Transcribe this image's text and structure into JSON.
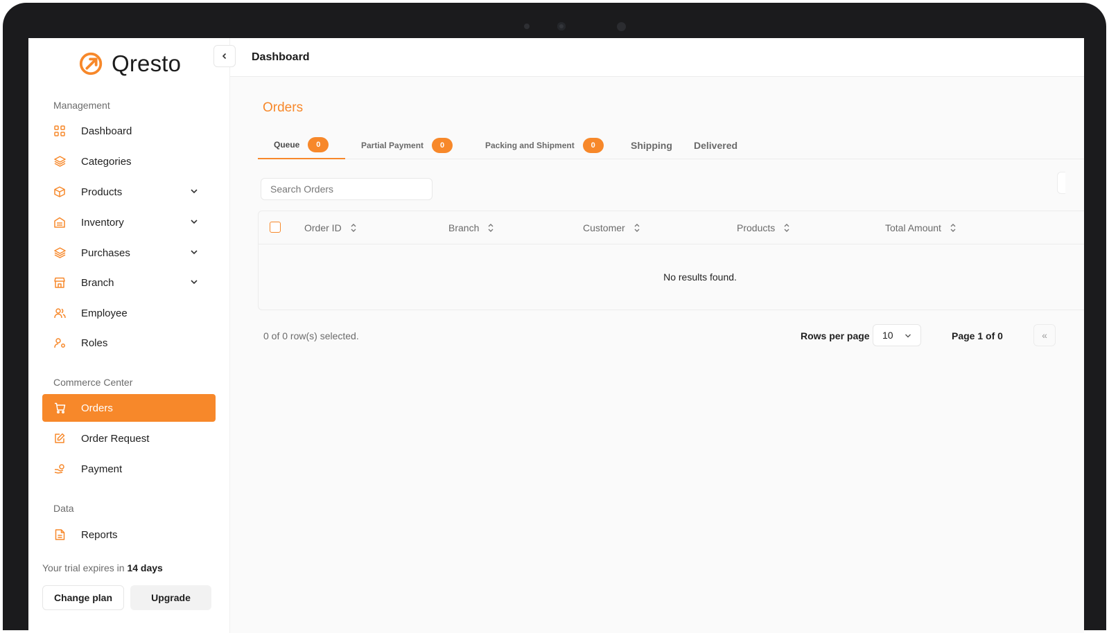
{
  "brand": {
    "name": "Qresto",
    "accent": "#f7882a"
  },
  "header": {
    "title": "Dashboard"
  },
  "sidebar": {
    "sections": [
      {
        "title": "Management"
      },
      {
        "title": "Commerce Center"
      },
      {
        "title": "Data"
      }
    ],
    "items": [
      {
        "label": "Dashboard",
        "icon": "grid-icon"
      },
      {
        "label": "Categories",
        "icon": "layers-icon"
      },
      {
        "label": "Products",
        "icon": "box-icon",
        "expandable": true
      },
      {
        "label": "Inventory",
        "icon": "warehouse-icon",
        "expandable": true
      },
      {
        "label": "Purchases",
        "icon": "layers-icon",
        "expandable": true
      },
      {
        "label": "Branch",
        "icon": "store-icon",
        "expandable": true
      },
      {
        "label": "Employee",
        "icon": "users-icon"
      },
      {
        "label": "Roles",
        "icon": "user-key-icon"
      },
      {
        "label": "Orders",
        "icon": "cart-icon",
        "active": true
      },
      {
        "label": "Order Request",
        "icon": "edit-icon"
      },
      {
        "label": "Payment",
        "icon": "hand-coin-icon"
      },
      {
        "label": "Reports",
        "icon": "file-icon"
      }
    ],
    "trial": {
      "prefix": "Your trial expires in",
      "days": "14 days"
    },
    "change_plan_label": "Change plan",
    "upgrade_label": "Upgrade"
  },
  "main": {
    "title": "Orders",
    "tabs": [
      {
        "label": "Queue",
        "count": "0",
        "active": true
      },
      {
        "label": "Partial Payment",
        "count": "0"
      },
      {
        "label": "Packing and Shipment",
        "count": "0"
      },
      {
        "label": "Shipping"
      },
      {
        "label": "Delivered"
      }
    ],
    "search": {
      "placeholder": "Search Orders"
    },
    "table": {
      "columns": [
        "Order ID",
        "Branch",
        "Customer",
        "Products",
        "Total Amount"
      ],
      "empty_text": "No results found."
    },
    "footer": {
      "selected_text": "0 of 0 row(s) selected.",
      "rows_per_page_label": "Rows per page",
      "rows_per_page_value": "10",
      "page_info": "Page 1 of 0",
      "first_page_glyph": "«"
    }
  }
}
